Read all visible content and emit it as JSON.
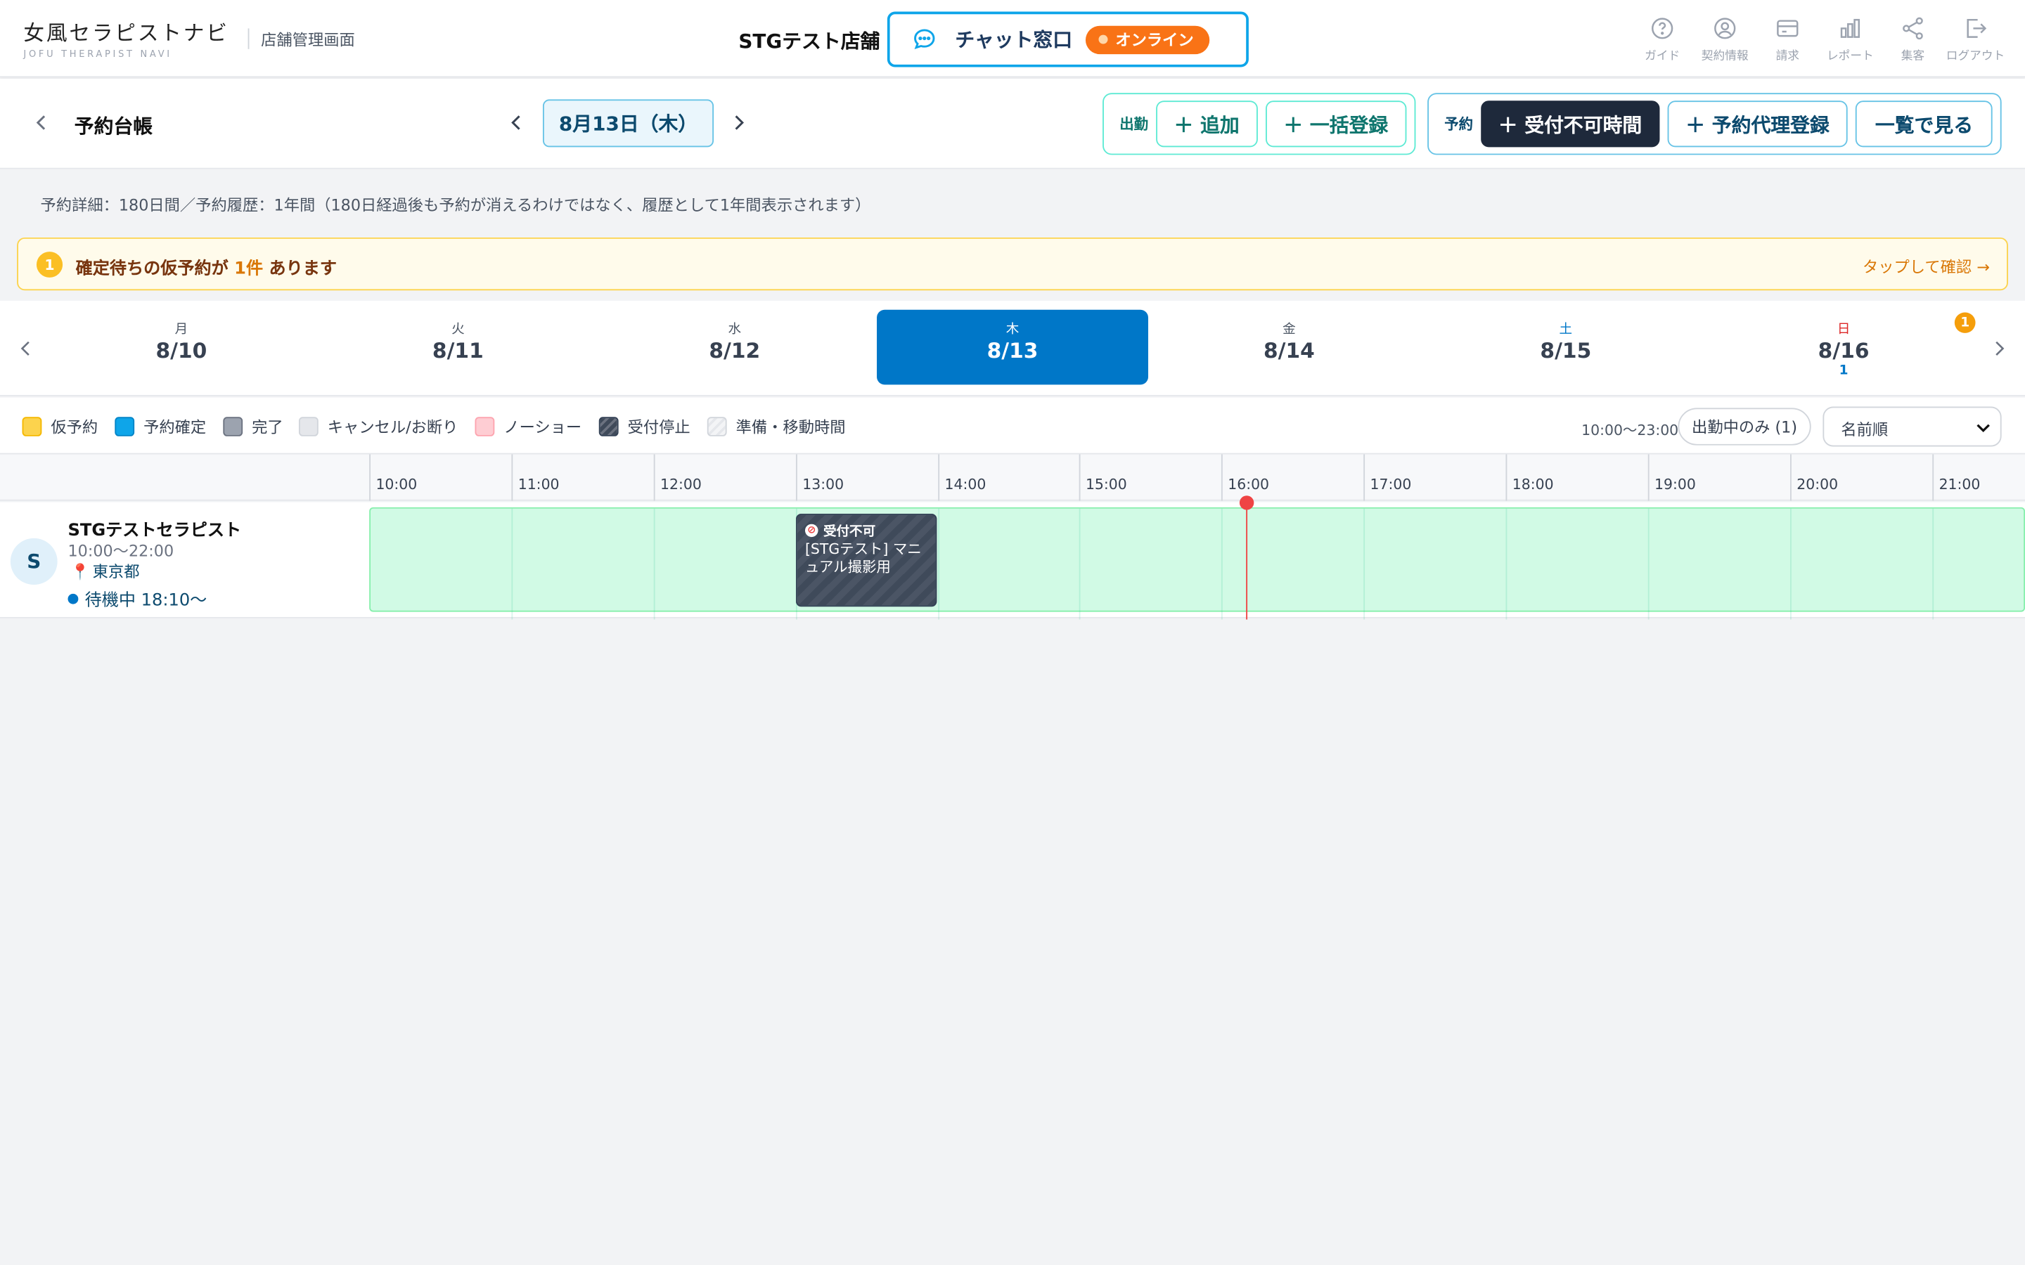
{
  "header": {
    "logo_main": "女風セラピストナビ",
    "logo_sub": "JOFU THERAPIST NAVI",
    "admin_label": "店舗管理画面",
    "store_name": "STGテスト店舗",
    "chat_label": "チャット窓口",
    "online_label": "オンライン",
    "nav": [
      {
        "label": "ガイド",
        "icon": "help-circle-icon"
      },
      {
        "label": "契約情報",
        "icon": "user-circle-icon"
      },
      {
        "label": "請求",
        "icon": "credit-card-icon"
      },
      {
        "label": "レポート",
        "icon": "bar-chart-icon"
      },
      {
        "label": "集客",
        "icon": "share-icon"
      },
      {
        "label": "ログアウト",
        "icon": "logout-icon"
      }
    ]
  },
  "toolbar": {
    "title": "予約台帳",
    "date": "8月13日（木）",
    "attendance_group": "出勤",
    "add_label": "＋ 追加",
    "bulk_label": "＋ 一括登録",
    "reservation_group": "予約",
    "unavailable_label": "＋ 受付不可時間",
    "proxy_label": "＋ 予約代理登録",
    "list_label": "一覧で見る"
  },
  "info": {
    "note": "予約詳細：180日間／予約履歴：1年間（180日経過後も予約が消えるわけではなく、履歴として1年間表示されます）",
    "alert_count_badge": "1",
    "alert_prefix": "確定待ちの仮予約が",
    "alert_count": "1件",
    "alert_suffix": "あります",
    "alert_link": "タップして確認 →"
  },
  "week": {
    "days": [
      {
        "weekday": "月",
        "date": "8/10",
        "count": ""
      },
      {
        "weekday": "火",
        "date": "8/11",
        "count": ""
      },
      {
        "weekday": "水",
        "date": "8/12",
        "count": ""
      },
      {
        "weekday": "木",
        "date": "8/13",
        "count": ""
      },
      {
        "weekday": "金",
        "date": "8/14",
        "count": ""
      },
      {
        "weekday": "土",
        "date": "8/15",
        "count": ""
      },
      {
        "weekday": "日",
        "date": "8/16",
        "count": "1"
      }
    ],
    "selected_index": 3,
    "badge": "1"
  },
  "legend": {
    "items": [
      {
        "label": "仮予約",
        "color": "#fcd34d"
      },
      {
        "label": "予約確定",
        "color": "#0ea5e9"
      },
      {
        "label": "完了",
        "color": "#9ca3af"
      },
      {
        "label": "キャンセル/お断り",
        "color": "#e5e7eb"
      },
      {
        "label": "ノーショー",
        "color": "#fecdd3"
      },
      {
        "label": "受付停止",
        "color": "#4b5565"
      },
      {
        "label": "準備・移動時間",
        "color": "#f3f4f6"
      }
    ],
    "range": "10:00〜23:00",
    "on_duty_filter": "出勤中のみ (1)",
    "sort": "名前順"
  },
  "timeline": {
    "hours": [
      "10:00",
      "11:00",
      "12:00",
      "13:00",
      "14:00",
      "15:00",
      "16:00",
      "17:00",
      "18:00",
      "19:00",
      "20:00",
      "21:00"
    ],
    "now": "16:00",
    "therapist": {
      "initial": "S",
      "name": "STGテストセラピスト",
      "hours": "10:00〜22:00",
      "area": "東京都",
      "status": "待機中 18:10〜"
    },
    "block": {
      "title": "受付不可",
      "text": "[STGテスト] マニュアル撮影用",
      "start": "13:00",
      "end": "14:00"
    }
  }
}
